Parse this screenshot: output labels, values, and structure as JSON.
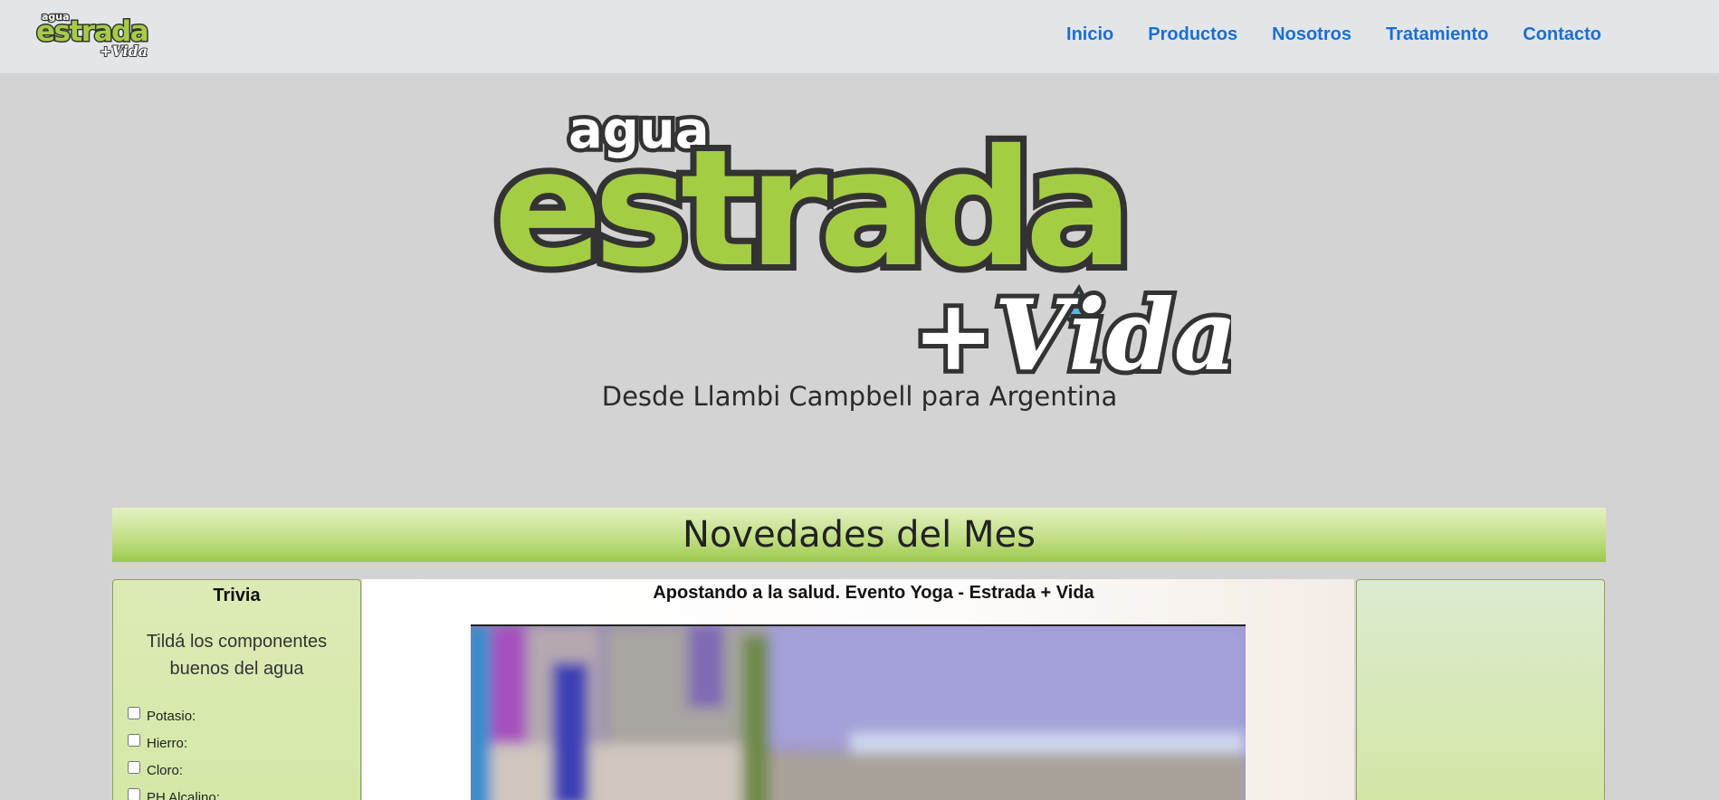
{
  "brand": {
    "logo_text_small": "agua",
    "logo_text_main": "estrada",
    "logo_text_tag": "+Vida",
    "colors": {
      "green": "#a4cd44",
      "dark": "#333333",
      "navy": "#1a6fd4"
    }
  },
  "nav": {
    "items": [
      {
        "label": "Inicio"
      },
      {
        "label": "Productos"
      },
      {
        "label": "Nosotros"
      },
      {
        "label": "Tratamiento"
      },
      {
        "label": "Contacto"
      }
    ]
  },
  "hero": {
    "subtitle": "Desde Llambi Campbell para Argentina"
  },
  "news": {
    "banner_title": "Novedades del Mes"
  },
  "trivia": {
    "title": "Trivia",
    "question": "Tildá los componentes buenos del agua",
    "options": [
      {
        "label": "Potasio:",
        "checked": false
      },
      {
        "label": "Hierro:",
        "checked": false
      },
      {
        "label": "Cloro:",
        "checked": false
      },
      {
        "label": "PH Alcalino:",
        "checked": false
      }
    ]
  },
  "article": {
    "title": "Apostando a la salud. Evento Yoga - Estrada + Vida"
  }
}
